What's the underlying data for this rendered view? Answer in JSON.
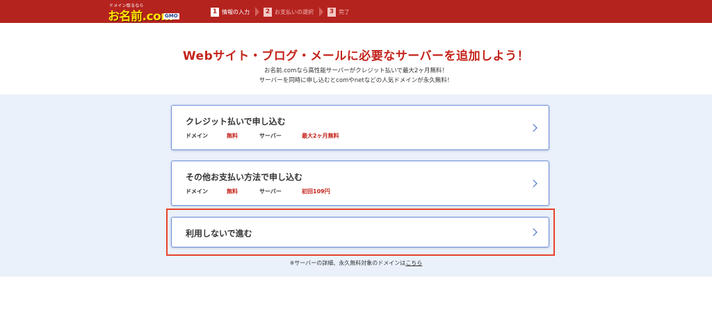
{
  "header": {
    "logo_tagline": "ドメイン取るなら",
    "logo_text": "お名前.com",
    "logo_badge": "GMO",
    "steps": [
      {
        "num": "1",
        "label": "情報の入力"
      },
      {
        "num": "2",
        "label": "お支払いの選択"
      },
      {
        "num": "3",
        "label": "完了"
      }
    ]
  },
  "hero": {
    "title": "Webサイト・ブログ・メールに必要なサーバーを追加しよう！",
    "subtitle_line1": "お名前.comなら高性能サーバーがクレジット払いで最大2ヶ月無料！",
    "subtitle_line2": "サーバーを同時に申し込むとcomやnetなどの人気ドメインが永久無料！"
  },
  "options": [
    {
      "title": "クレジット払いで申し込む",
      "domain_label": "ドメイン",
      "domain_value": "無料",
      "server_label": "サーバー",
      "server_value": "最大2ヶ月無料"
    },
    {
      "title": "その他お支払い方法で申し込む",
      "domain_label": "ドメイン",
      "domain_value": "無料",
      "server_label": "サーバー",
      "server_value": "初回109円"
    },
    {
      "title": "利用しないで進む"
    }
  ],
  "footnote": {
    "text": "※サーバーの詳細、永久無料対象のドメインは",
    "link": "こちら"
  },
  "colors": {
    "brand_red": "#b5231f",
    "accent_red": "#c4241c",
    "highlight": "#e8412b",
    "link_blue": "#2f62c7",
    "panel_bg": "#ebf1fa"
  }
}
